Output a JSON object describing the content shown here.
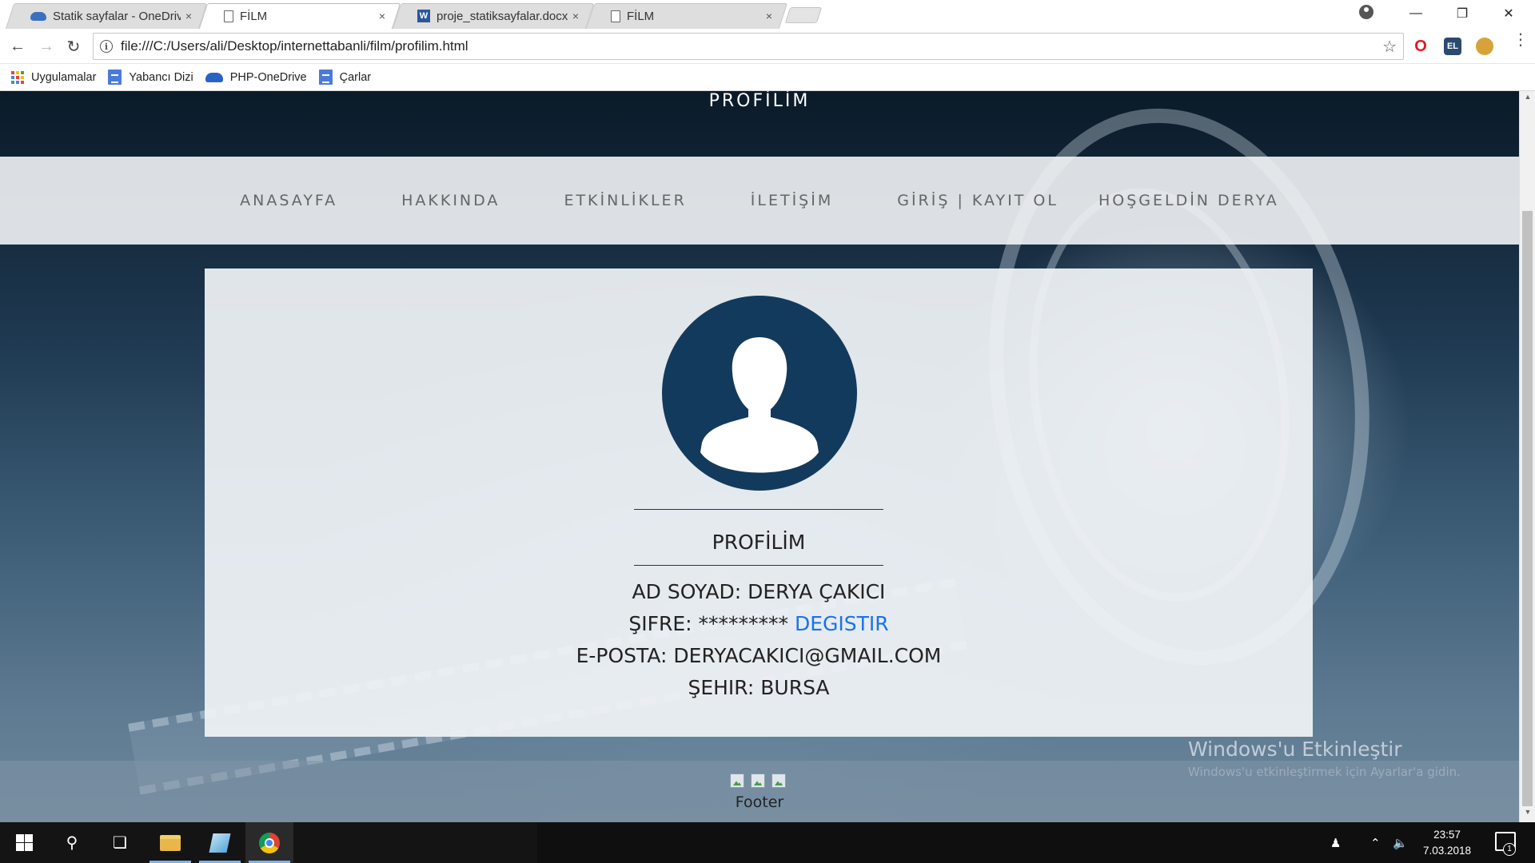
{
  "browser": {
    "tabs": [
      {
        "label": "Statik sayfalar - OneDrive",
        "favicon": "onedrive-icon",
        "active": false
      },
      {
        "label": "FİLM",
        "favicon": "page-icon",
        "active": true
      },
      {
        "label": "proje_statiksayfalar.docx",
        "favicon": "word-icon",
        "active": false
      },
      {
        "label": "FİLM",
        "favicon": "page-icon",
        "active": false
      }
    ],
    "tab_close_glyph": "×",
    "url": "file:///C:/Users/ali/Desktop/internettabanli/film/profilim.html",
    "bookmarks": [
      {
        "label": "Uygulamalar",
        "icon": "apps-grid-icon"
      },
      {
        "label": "Yabancı Dizi",
        "icon": "doc-icon"
      },
      {
        "label": "PHP-OneDrive",
        "icon": "onedrive-icon"
      },
      {
        "label": "Çarlar",
        "icon": "doc-icon"
      }
    ],
    "extensions": [
      {
        "name": "opera-icon",
        "glyph": "O",
        "color": "#e0192a"
      },
      {
        "name": "extension-el-icon",
        "glyph": "EL",
        "color": "#2b4a6e"
      },
      {
        "name": "cookie-icon",
        "glyph": "",
        "color": "#d8a23a"
      }
    ]
  },
  "site": {
    "brand": "PROFİLİM",
    "nav": [
      "ANASAYFA",
      "HAKKINDA",
      "ETKİNLİKLER",
      "İLETİŞİM",
      "GİRİŞ | KAYIT OL",
      "HOŞGELDİN DERYA"
    ],
    "profile": {
      "title": "PROFİLİM",
      "name_row": "AD SOYAD: DERYA ÇAKICI",
      "password_label": "ŞIFRE: ********* ",
      "password_link": "DEGISTIR",
      "email_row": "E-POSTA: DERYACAKICI@GMAIL.COM",
      "city_row": "ŞEHIR: BURSA"
    },
    "footer_text": "Footer",
    "footer_broken_images": 3
  },
  "watermark": {
    "title": "Windows'u Etkinleştir",
    "subtitle": "Windows'u etkinleştirmek için Ayarlar'a gidin."
  },
  "taskbar": {
    "time": "23:57",
    "date": "7.03.2018",
    "notification_count": "1"
  },
  "colors": {
    "avatar_bg": "#123a5c",
    "link": "#1a73e8",
    "nav_text": "#666666"
  }
}
